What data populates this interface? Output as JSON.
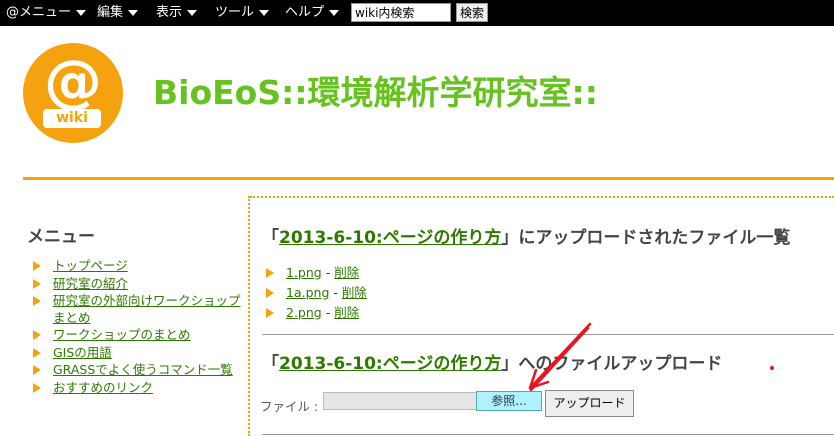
{
  "topbar": {
    "menus": [
      "@メニュー",
      "編集",
      "表示",
      "ツール",
      "ヘルプ"
    ],
    "search_value": "wiki内検索",
    "search_button": "検索"
  },
  "header": {
    "logo_at": "@",
    "logo_wiki": "wiki",
    "site_title": "BioEoS::環境解析学研究室::"
  },
  "sidebar": {
    "title": "メニュー",
    "items": [
      "トップページ",
      "研究室の紹介",
      "研究室の外部向けワークショップまとめ",
      "ワークショップのまとめ",
      "GISの用語",
      "GRASSでよく使うコマンド一覧",
      "おすすめのリンク"
    ]
  },
  "main": {
    "list_heading": {
      "open": "「",
      "page": "2013-6-10:ページの作り方",
      "close": "」にアップロードされたファイル一覧"
    },
    "files": [
      {
        "name": "1.png",
        "sep": " - ",
        "delete": "削除"
      },
      {
        "name": "1a.png",
        "sep": " - ",
        "delete": "削除"
      },
      {
        "name": "2.png",
        "sep": " - ",
        "delete": "削除"
      }
    ],
    "upload_heading": {
      "open": "「",
      "page": "2013-6-10:ページの作り方",
      "close": "」へのファイルアップロード"
    },
    "file_label": "ファイル :",
    "browse_button": "参照...",
    "upload_button": "アップロード"
  },
  "colors": {
    "accent": "#f5a20f",
    "title_green": "#66c21f",
    "link_green": "#2e7a00",
    "annotation_red": "#e8141e"
  }
}
